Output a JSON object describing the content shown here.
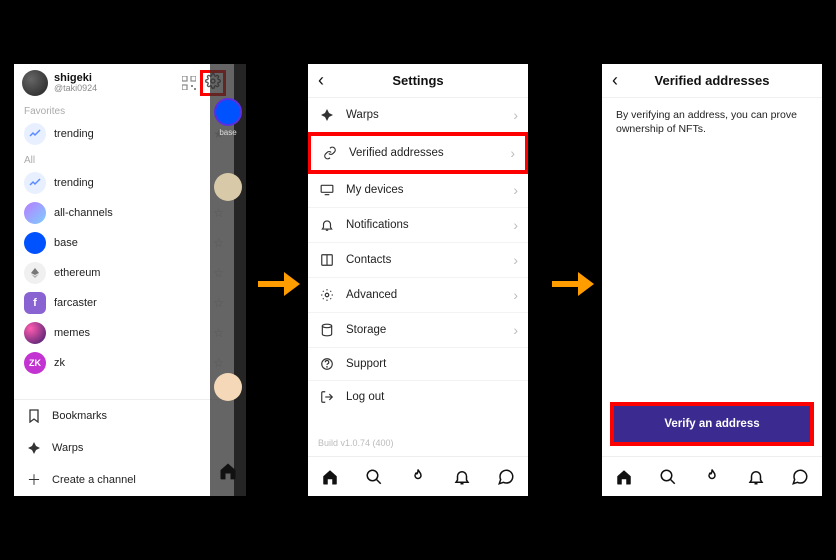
{
  "phone1": {
    "username": "shigeki",
    "handle": "@taki0924",
    "sections": {
      "favorites_label": "Favorites",
      "all_label": "All"
    },
    "favorites": [
      {
        "label": "trending"
      }
    ],
    "all": [
      {
        "label": "trending"
      },
      {
        "label": "all-channels"
      },
      {
        "label": "base"
      },
      {
        "label": "ethereum"
      },
      {
        "label": "farcaster"
      },
      {
        "label": "memes"
      },
      {
        "label": "zk"
      }
    ],
    "bottom": {
      "bookmarks": "Bookmarks",
      "warps": "Warps",
      "create": "Create a channel"
    },
    "story_label": "base"
  },
  "phone2": {
    "title": "Settings",
    "rows": [
      {
        "label": "Warps"
      },
      {
        "label": "Verified addresses"
      },
      {
        "label": "My devices"
      },
      {
        "label": "Notifications"
      },
      {
        "label": "Contacts"
      },
      {
        "label": "Advanced"
      },
      {
        "label": "Storage"
      },
      {
        "label": "Support"
      },
      {
        "label": "Log out"
      }
    ],
    "build": "Build v1.0.74 (400)"
  },
  "phone3": {
    "title": "Verified addresses",
    "description": "By verifying an address, you can prove ownership of NFTs.",
    "cta": "Verify an address"
  }
}
